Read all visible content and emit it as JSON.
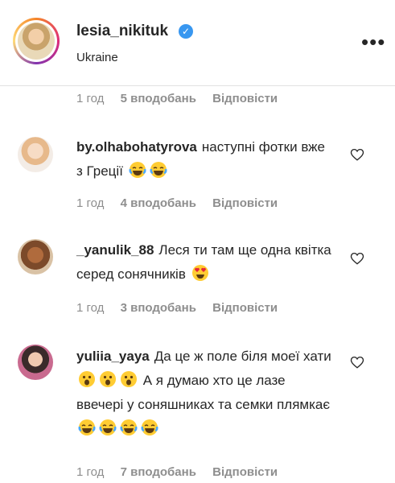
{
  "post": {
    "username": "lesia_nikituk",
    "location": "Ukraine",
    "more_label": "•••"
  },
  "top_meta": {
    "time": "1 год",
    "likes": "5 вподобань",
    "reply": "Відповісти"
  },
  "comments": [
    {
      "user": "by.olhabohatyrova",
      "text": "наступні фотки вже з Греції",
      "emojis": [
        "tears-of-joy",
        "tears-of-joy"
      ],
      "time": "1 год",
      "likes": "4 вподобань",
      "reply": "Відповісти"
    },
    {
      "user": "_yanulik_88",
      "text": "Леся ти там ще одна квітка серед сонячників",
      "emojis": [
        "heart-eyes"
      ],
      "time": "1 год",
      "likes": "3 вподобань",
      "reply": "Відповісти"
    },
    {
      "user": "yuliia_yaya",
      "text_1": "Да це ж поле біля моеї хати",
      "emojis_1": [
        "astonished",
        "astonished",
        "astonished"
      ],
      "text_2": "А я думаю хто це лазе ввечері у соняшниках та семки плямкає",
      "emojis_2": [
        "tears-of-joy",
        "tears-of-joy",
        "tears-of-joy",
        "tears-of-joy"
      ],
      "time": "1 год",
      "likes": "7 вподобань",
      "reply": "Відповісти"
    }
  ],
  "colors": {
    "text": "#262626",
    "muted": "#8e8e8e",
    "verified": "#3897f0",
    "emoji": "#ffcc33"
  }
}
